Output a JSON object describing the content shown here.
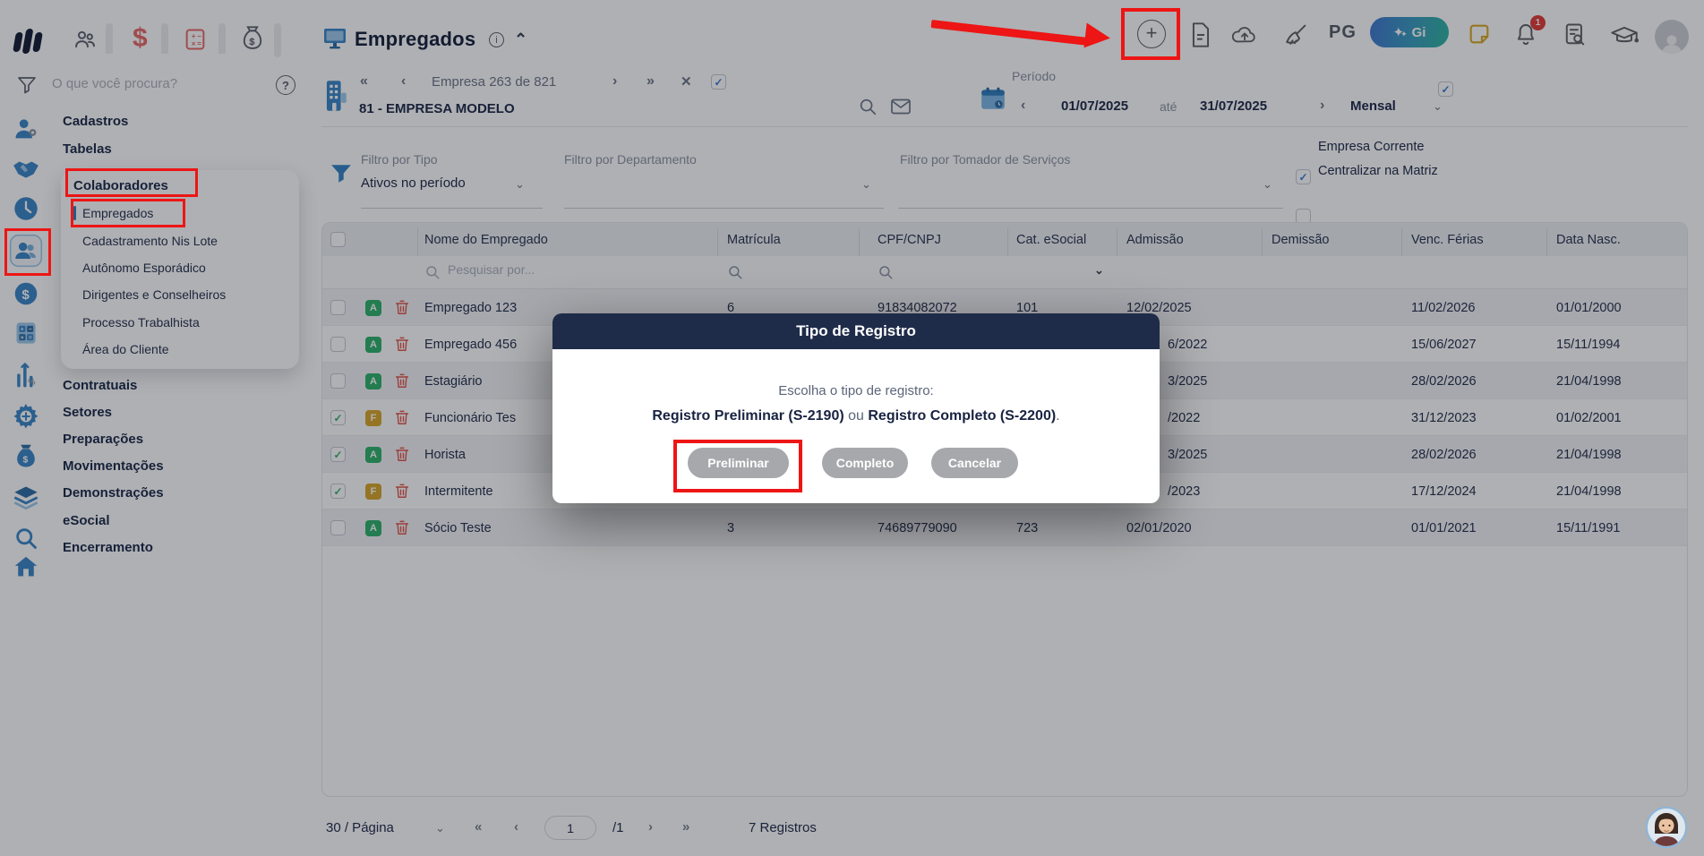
{
  "colors": {
    "annotation_red": "#ed1515",
    "accent_blue": "#3583c6",
    "navy": "#1e2a4a",
    "badge_green": "#2fb46c",
    "badge_gold": "#d9a72b",
    "modal_header": "#1f2c49"
  },
  "topbar": {
    "title": "Empregados",
    "pg_label": "PG",
    "gi_label": "Gi",
    "bell_badge": "1"
  },
  "sidebar": {
    "search_placeholder": "O que você procura?",
    "top_items": [
      "Cadastros",
      "Tabelas"
    ],
    "group_title": "Colaboradores",
    "group_items": [
      "Empregados",
      "Cadastramento Nis Lote",
      "Autônomo Esporádico",
      "Dirigentes e Conselheiros",
      "Processo Trabalhista",
      "Área do Cliente"
    ],
    "bottom_items": [
      "Contratuais",
      "Setores",
      "Preparações",
      "Movimentações",
      "Demonstrações",
      "eSocial",
      "Encerramento"
    ]
  },
  "company": {
    "nav_text": "Empresa 263 de 821",
    "name": "81 - EMPRESA MODELO",
    "period_label": "Período",
    "period_start": "01/07/2025",
    "period_sep": "até",
    "period_end": "31/07/2025",
    "period_mode": "Mensal",
    "chk_current": "Empresa Corrente",
    "chk_matrix": "Centralizar na Matriz"
  },
  "filters": {
    "tipo_label": "Filtro por Tipo",
    "tipo_value": "Ativos no período",
    "dept_label": "Filtro por Departamento",
    "tomador_label": "Filtro por Tomador de Serviços"
  },
  "table": {
    "columns": [
      "Nome do Empregado",
      "Matrícula",
      "CPF/CNPJ",
      "Cat. eSocial",
      "Admissão",
      "Demissão",
      "Venc. Férias",
      "Data Nasc."
    ],
    "search_placeholder": "Pesquisar por...",
    "rows": [
      {
        "checked": false,
        "badge": "A",
        "name": "Empregado 123",
        "matricula": "6",
        "cpf": "91834082072",
        "cat": "101",
        "admissao": "12/02/2025",
        "demissao": "",
        "venc_ferias": "11/02/2026",
        "data_nasc": "01/01/2000",
        "partial": false
      },
      {
        "checked": false,
        "badge": "A",
        "name": "Empregado 456",
        "matricula": "",
        "cpf": "",
        "cat": "",
        "admissao": "6/2022",
        "demissao": "",
        "venc_ferias": "15/06/2027",
        "data_nasc": "15/11/1994",
        "partial": true
      },
      {
        "checked": false,
        "badge": "A",
        "name": "Estagiário",
        "matricula": "",
        "cpf": "",
        "cat": "",
        "admissao": "3/2025",
        "demissao": "",
        "venc_ferias": "28/02/2026",
        "data_nasc": "21/04/1998",
        "partial": true
      },
      {
        "checked": true,
        "badge": "F",
        "name": "Funcionário Tes",
        "matricula": "",
        "cpf": "",
        "cat": "",
        "admissao": "/2022",
        "demissao": "",
        "venc_ferias": "31/12/2023",
        "data_nasc": "01/02/2001",
        "partial": true
      },
      {
        "checked": true,
        "badge": "A",
        "name": "Horista",
        "matricula": "",
        "cpf": "",
        "cat": "",
        "admissao": "3/2025",
        "demissao": "",
        "venc_ferias": "28/02/2026",
        "data_nasc": "21/04/1998",
        "partial": true
      },
      {
        "checked": true,
        "badge": "F",
        "name": "Intermitente",
        "matricula": "",
        "cpf": "",
        "cat": "",
        "admissao": "/2023",
        "demissao": "",
        "venc_ferias": "17/12/2024",
        "data_nasc": "21/04/1998",
        "partial": true
      },
      {
        "checked": false,
        "badge": "A",
        "name": "Sócio Teste",
        "matricula": "3",
        "cpf": "74689779090",
        "cat": "723",
        "admissao": "02/01/2020",
        "demissao": "",
        "venc_ferias": "01/01/2021",
        "data_nasc": "15/11/1991",
        "partial": false
      }
    ]
  },
  "modal": {
    "title": "Tipo de Registro",
    "line1": "Escolha o tipo de registro:",
    "bold1": "Registro Preliminar (S-2190)",
    "mid": " ou ",
    "bold2": "Registro Completo (S-2200)",
    "end": ".",
    "btn_preliminar": "Preliminar",
    "btn_completo": "Completo",
    "btn_cancelar": "Cancelar"
  },
  "pagination": {
    "page_size": "30 / Página",
    "current_page": "1",
    "total": "/1",
    "records": "7 Registros"
  }
}
